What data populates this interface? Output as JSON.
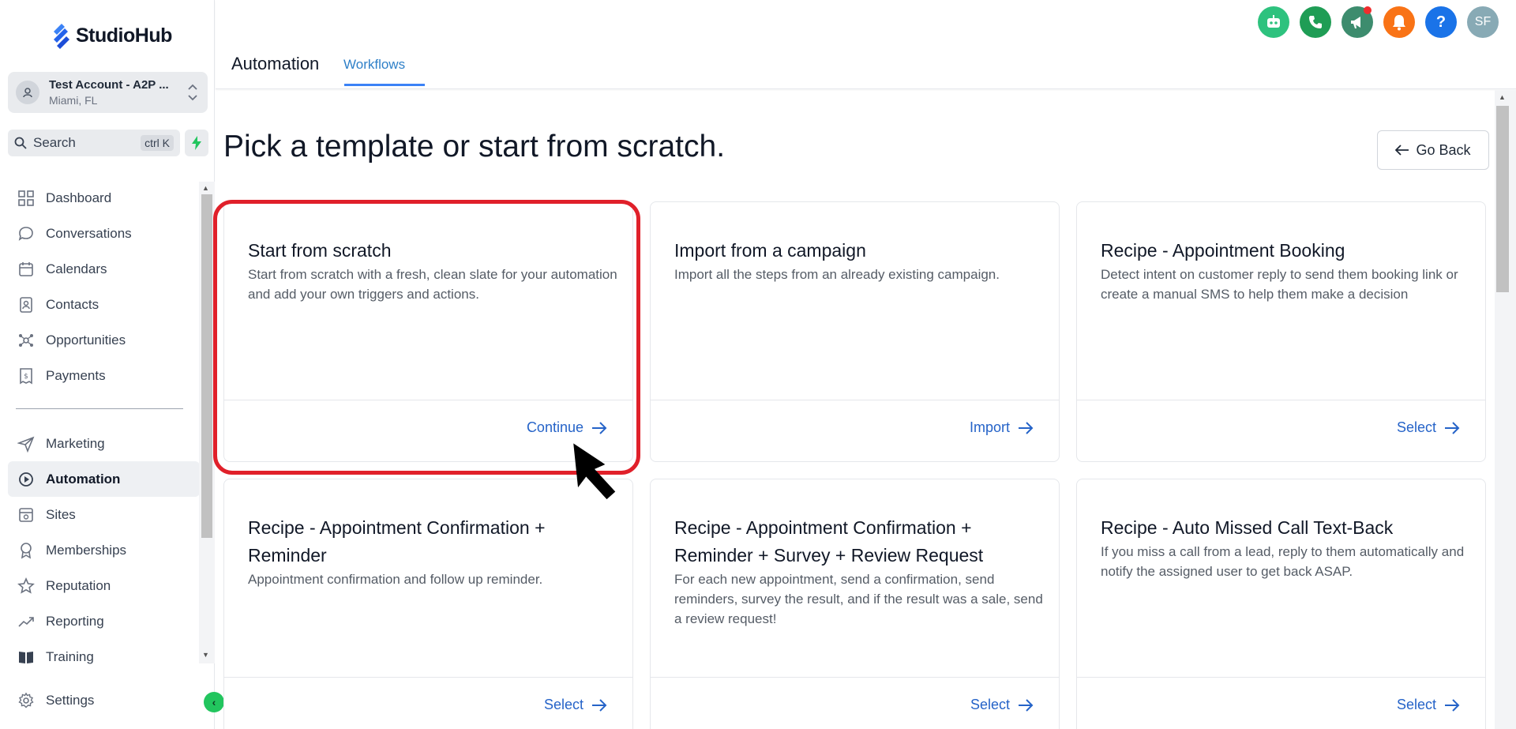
{
  "app": {
    "name": "StudioHub"
  },
  "account": {
    "name": "Test Account - A2P ...",
    "location": "Miami, FL"
  },
  "search": {
    "label": "Search",
    "shortcut": "ctrl K"
  },
  "nav": {
    "top": [
      {
        "label": "Dashboard",
        "icon": "dashboard-icon"
      },
      {
        "label": "Conversations",
        "icon": "chat-icon"
      },
      {
        "label": "Calendars",
        "icon": "calendar-icon"
      },
      {
        "label": "Contacts",
        "icon": "contacts-icon"
      },
      {
        "label": "Opportunities",
        "icon": "opportunities-icon"
      },
      {
        "label": "Payments",
        "icon": "payments-icon"
      }
    ],
    "bottom": [
      {
        "label": "Marketing",
        "icon": "send-icon"
      },
      {
        "label": "Automation",
        "icon": "automation-icon",
        "active": true
      },
      {
        "label": "Sites",
        "icon": "sites-icon"
      },
      {
        "label": "Memberships",
        "icon": "memberships-icon"
      },
      {
        "label": "Reputation",
        "icon": "star-icon"
      },
      {
        "label": "Reporting",
        "icon": "trend-icon"
      },
      {
        "label": "Training",
        "icon": "book-icon"
      }
    ],
    "settings": {
      "label": "Settings",
      "icon": "gear-icon"
    }
  },
  "header": {
    "title": "Automation",
    "tab": "Workflows",
    "avatar_initials": "SF",
    "icons": [
      "robot-icon",
      "phone-icon",
      "megaphone-icon",
      "bell-icon",
      "help-icon",
      "avatar"
    ],
    "colors": {
      "robot": "#2ec27e",
      "phone": "#1f9d55",
      "megaphone": "#3d8c6e",
      "bell": "#f97316",
      "help": "#1a73e8",
      "avatar": "#88aab5"
    }
  },
  "main": {
    "heading": "Pick a template or start from scratch.",
    "go_back": "Go Back",
    "cards": [
      {
        "title": "Start from scratch",
        "desc": "Start from scratch with a fresh, clean slate for your automation and add your own triggers and actions.",
        "action": "Continue"
      },
      {
        "title": "Import from a campaign",
        "desc": "Import all the steps from an already existing campaign.",
        "action": "Import"
      },
      {
        "title": "Recipe - Appointment Booking",
        "desc": "Detect intent on customer reply to send them booking link or create a manual SMS to help them make a decision",
        "action": "Select"
      },
      {
        "title": "Recipe - Appointment Confirmation + Reminder",
        "desc": "Appointment confirmation and follow up reminder.",
        "action": "Select"
      },
      {
        "title": "Recipe - Appointment Confirmation + Reminder + Survey + Review Request",
        "desc": "For each new appointment, send a confirmation, send reminders, survey the result, and if the result was a sale, send a review request!",
        "action": "Select"
      },
      {
        "title": "Recipe - Auto Missed Call Text-Back",
        "desc": "If you miss a call from a lead, reply to them automatically and notify the assigned user to get back ASAP.",
        "action": "Select"
      }
    ]
  }
}
